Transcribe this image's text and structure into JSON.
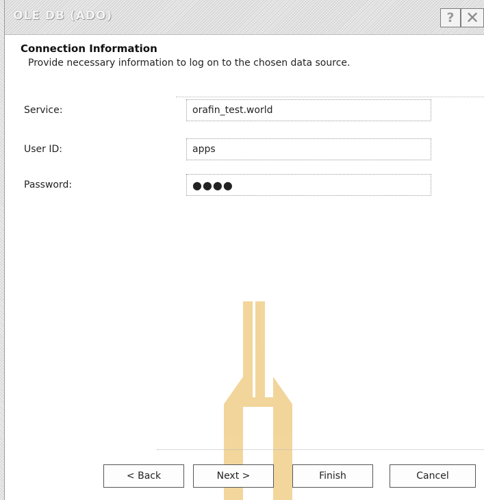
{
  "window": {
    "title": "OLE DB (ADO)",
    "help_glyph": "?",
    "close_glyph": "✕"
  },
  "header": {
    "title": "Connection Information",
    "subtitle": "Provide necessary information to log on to the chosen data source."
  },
  "form": {
    "service": {
      "label": "Service:",
      "value": "orafin_test.world"
    },
    "user_id": {
      "label": "User ID:",
      "value": "apps"
    },
    "password": {
      "label": "Password:",
      "value": "●●●●"
    }
  },
  "buttons": {
    "back": "< Back",
    "next": "Next >",
    "finish": "Finish",
    "cancel": "Cancel"
  },
  "colors": {
    "watermark": "#e8b44a"
  }
}
